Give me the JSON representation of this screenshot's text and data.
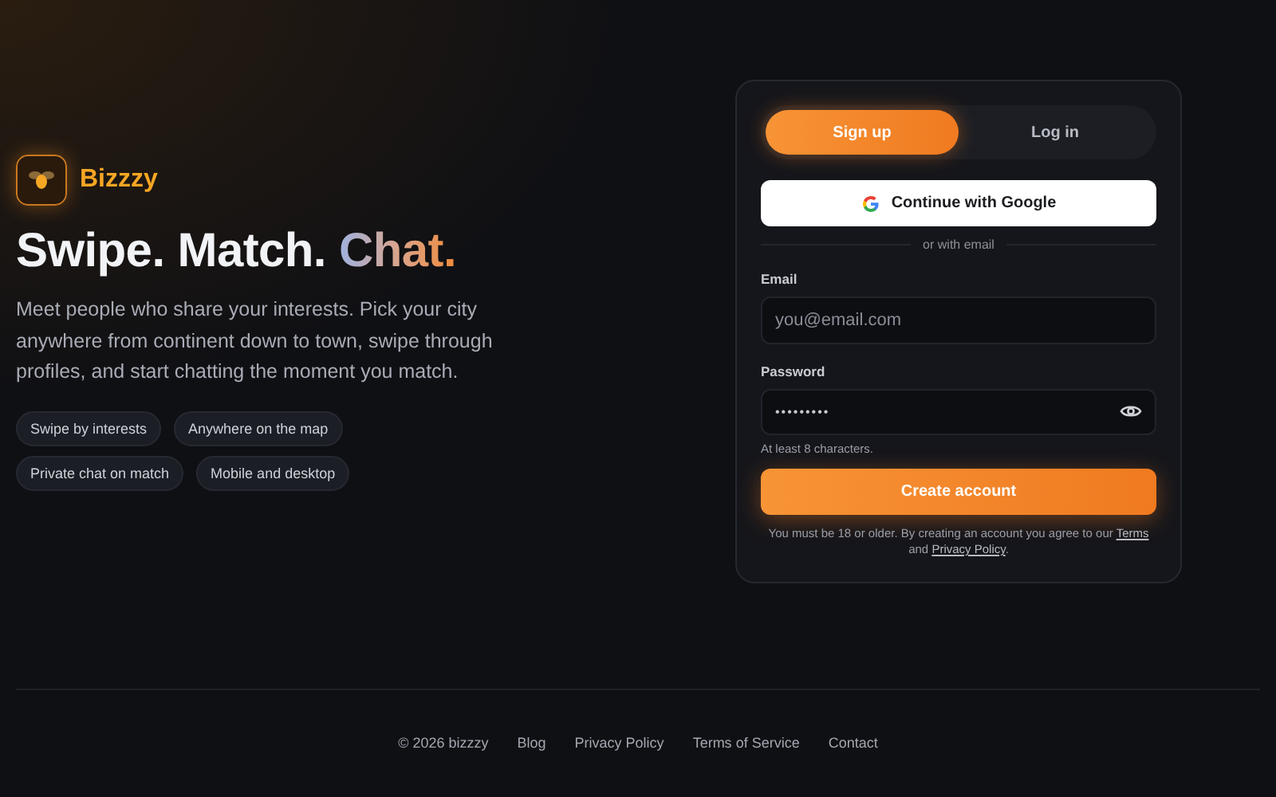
{
  "brand": {
    "name": "Bizzzy"
  },
  "headline": {
    "plain": "Swipe. Match.",
    "accent": "Chat."
  },
  "intro": "Meet people who share your interests. Pick your city anywhere from continent down to town, swipe through profiles, and start chatting the moment you match.",
  "features": [
    "Swipe by interests",
    "Anywhere on the map",
    "Private chat on match",
    "Mobile and desktop"
  ],
  "auth": {
    "tabs": [
      {
        "label": "Sign up",
        "selected": true
      },
      {
        "label": "Log in",
        "selected": false
      }
    ],
    "google_button": "Continue with Google",
    "divider": "or with email",
    "email": {
      "label": "Email",
      "placeholder": "you@email.com"
    },
    "password": {
      "label": "Password",
      "value": "•••••••••",
      "hint": "At least 8 characters."
    },
    "submit": "Create account",
    "legal": {
      "before": "You must be 18 or older. By creating an account you agree to our",
      "terms": "Terms",
      "middle": "and",
      "privacy": "Privacy Policy",
      "after": "."
    }
  },
  "footer": {
    "copyright": "© 2026 bizzzy",
    "links": [
      "Blog",
      "Privacy Policy",
      "Terms of Service",
      "Contact"
    ]
  }
}
